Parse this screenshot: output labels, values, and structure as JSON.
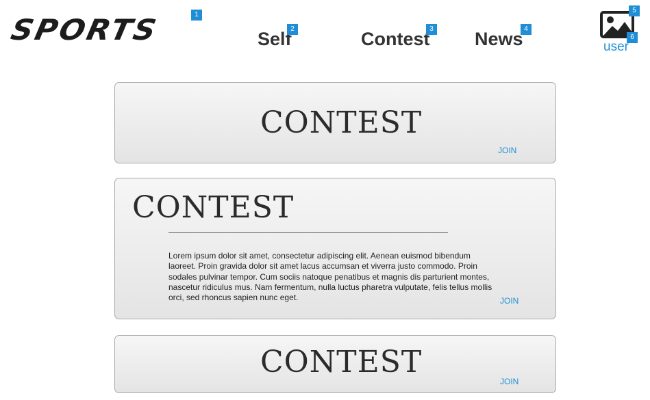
{
  "header": {
    "logo_text": "SPORTS",
    "nav": {
      "self": "Self",
      "contest": "Contest",
      "news": "News"
    },
    "user_label": "user",
    "user_icon": "image-placeholder-icon"
  },
  "annotations": [
    "1",
    "2",
    "3",
    "4",
    "5",
    "6"
  ],
  "cards": [
    {
      "title": "CONTEST",
      "join_label": "JOIN"
    },
    {
      "title": "CONTEST",
      "body": "Lorem ipsum dolor sit amet, consectetur adipiscing elit. Aenean euismod bibendum laoreet. Proin gravida dolor sit amet lacus accumsan et viverra justo commodo. Proin sodales pulvinar tempor. Cum sociis natoque penatibus et magnis dis parturient montes, nascetur ridiculus mus. Nam fermentum, nulla luctus pharetra vulputate, felis tellus mollis orci, sed rhoncus sapien nunc eget.",
      "join_label": "JOIN"
    },
    {
      "title": "CONTEST",
      "join_label": "JOIN"
    }
  ],
  "colors": {
    "accent": "#1f8ed6",
    "card_border": "#a9a9a9",
    "text_dark": "#2b2b2b"
  }
}
